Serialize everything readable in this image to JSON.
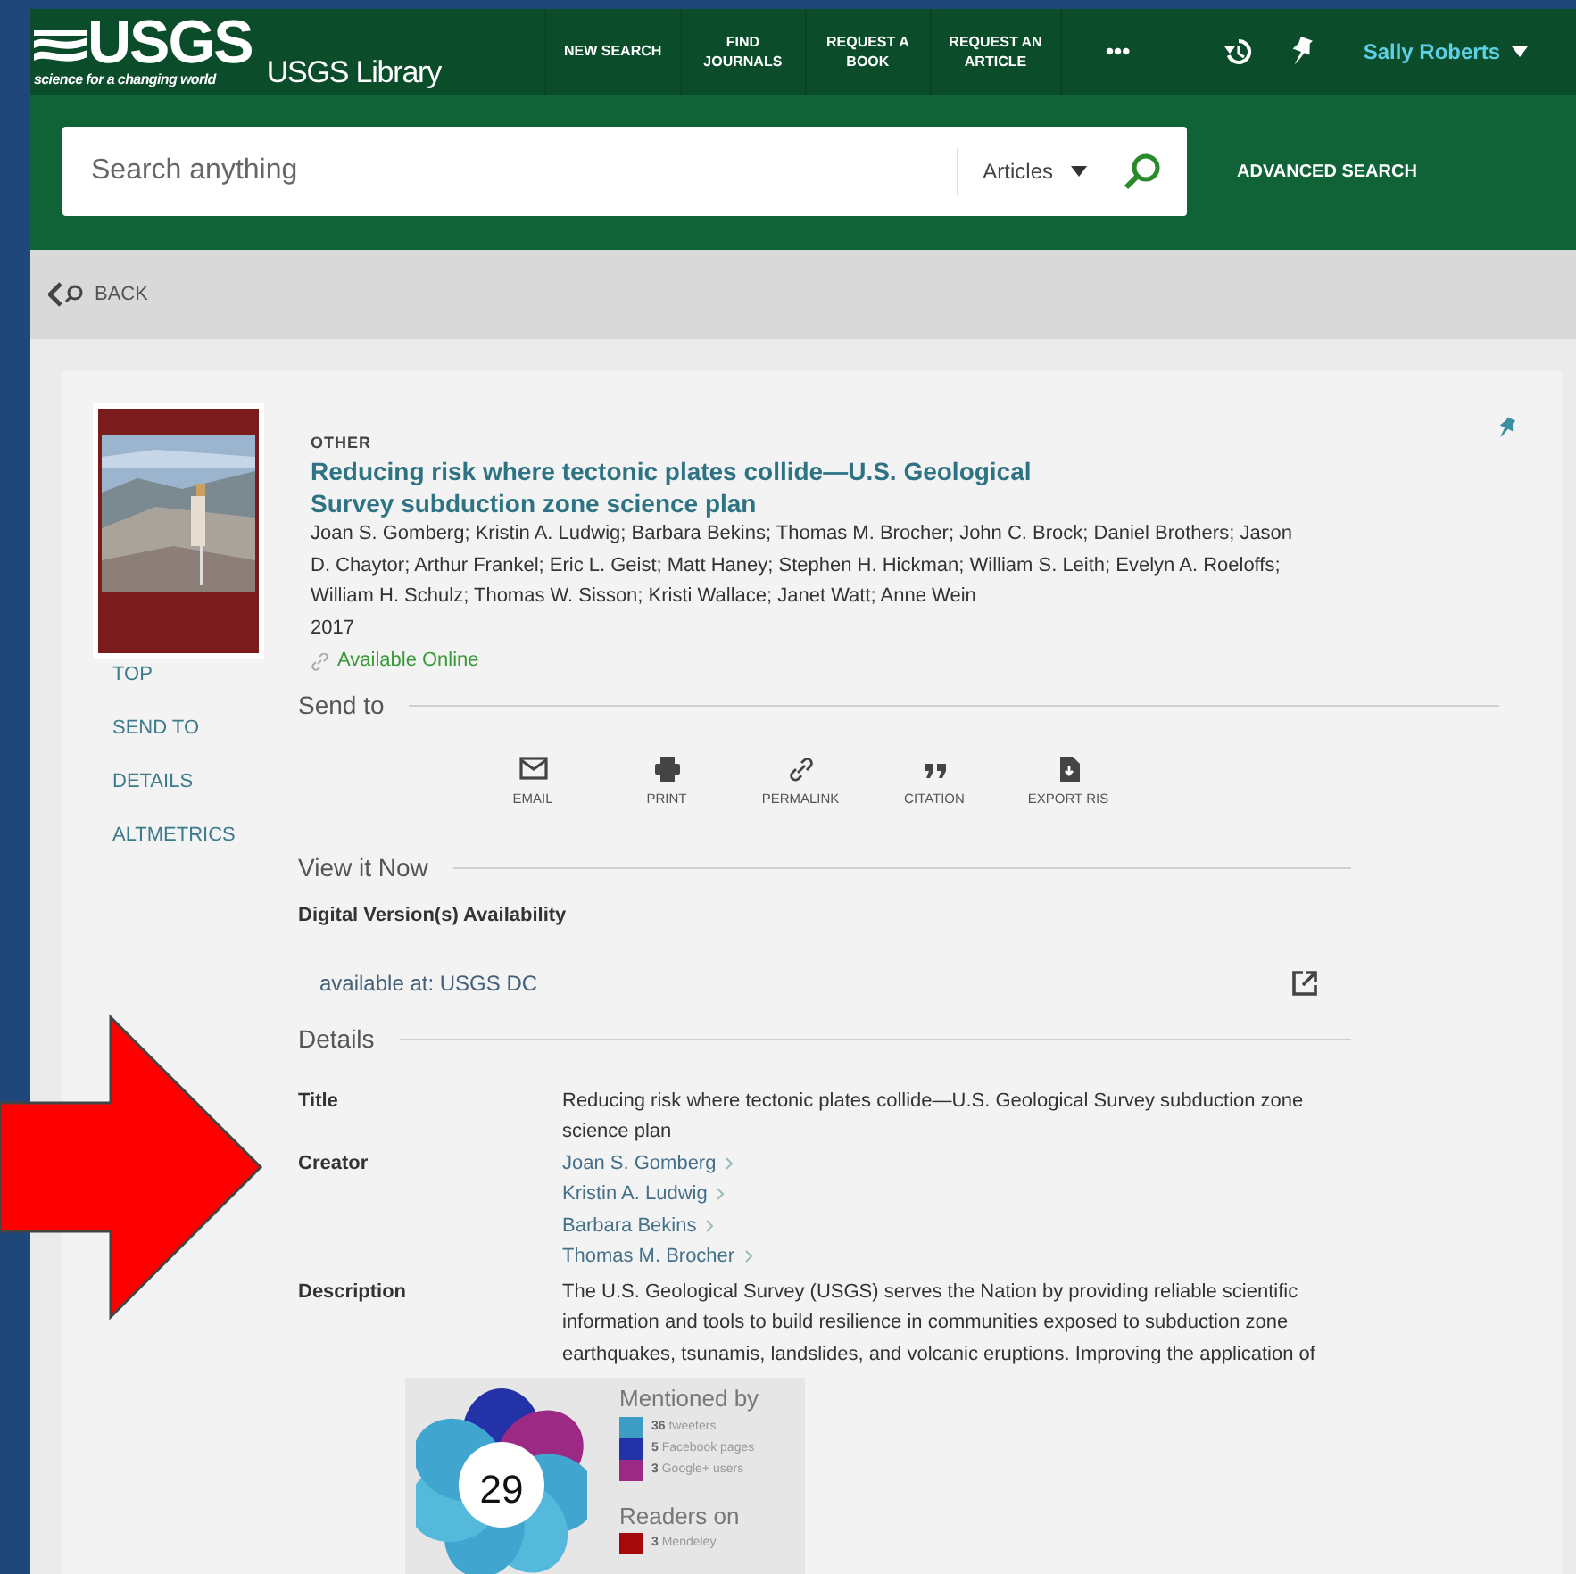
{
  "header": {
    "logo": {
      "brand": "USGS",
      "tagline": "science for a changing world"
    },
    "library_name": "USGS Library",
    "nav": [
      {
        "lines": [
          "NEW SEARCH"
        ]
      },
      {
        "lines": [
          "FIND",
          "JOURNALS"
        ]
      },
      {
        "lines": [
          "REQUEST A",
          "BOOK"
        ]
      },
      {
        "lines": [
          "REQUEST AN",
          "ARTICLE"
        ]
      },
      {
        "lines": [
          "•••"
        ]
      }
    ],
    "user": "Sally Roberts"
  },
  "search": {
    "placeholder": "Search anything",
    "scope": "Articles",
    "advanced": "ADVANCED SEARCH"
  },
  "back": "BACK",
  "record": {
    "type": "OTHER",
    "title": "Reducing risk where tectonic plates collide—U.S. Geological Survey subduction zone science plan",
    "authors": "Joan S. Gomberg; Kristin A. Ludwig; Barbara Bekins; Thomas M. Brocher; John C. Brock; Daniel Brothers; Jason D. Chaytor; Arthur Frankel; Eric L. Geist; Matt Haney; Stephen H. Hickman; William S. Leith; Evelyn A. Roeloffs; William H. Schulz; Thomas W. Sisson; Kristi Wallace; Janet Watt; Anne Wein",
    "year": "2017",
    "availability": "Available Online"
  },
  "side_nav": [
    "TOP",
    "SEND TO",
    "DETAILS",
    "ALTMETRICS"
  ],
  "send_to": {
    "heading": "Send to",
    "actions": [
      {
        "kind": "email",
        "label": "EMAIL"
      },
      {
        "kind": "print",
        "label": "PRINT"
      },
      {
        "kind": "permalink",
        "label": "PERMALINK"
      },
      {
        "kind": "citation",
        "label": "CITATION"
      },
      {
        "kind": "export",
        "label": "EXPORT RIS"
      }
    ]
  },
  "view_it_now": {
    "heading": "View it Now",
    "subheading": "Digital Version(s) Availability",
    "link": "available at: USGS DC"
  },
  "details": {
    "heading": "Details",
    "fields": [
      {
        "label": "Title",
        "value": "Reducing risk where tectonic plates collide—U.S. Geological Survey subduction zone science plan"
      },
      {
        "label": "Creator",
        "links": [
          "Joan S. Gomberg",
          "Kristin A. Ludwig",
          "Barbara Bekins",
          "Thomas M. Brocher"
        ]
      },
      {
        "label": "Description",
        "value": "The U.S. Geological Survey (USGS) serves the Nation by providing reliable scientific information and tools to build resilience in communities exposed to subduction zone earthquakes, tsunamis, landslides, and volcanic eruptions. Improving the application of"
      }
    ]
  },
  "altmetric": {
    "score": "29",
    "mentioned_heading": "Mentioned by",
    "mentions": [
      {
        "count": "36",
        "label": "tweeters",
        "color": "#3c9cc4"
      },
      {
        "count": "5",
        "label": "Facebook pages",
        "color": "#2432a8"
      },
      {
        "count": "3",
        "label": "Google+ users",
        "color": "#9c2a84"
      }
    ],
    "readers_heading": "Readers on",
    "readers": [
      {
        "count": "3",
        "label": "Mendeley",
        "color": "#a50a0a"
      }
    ]
  }
}
